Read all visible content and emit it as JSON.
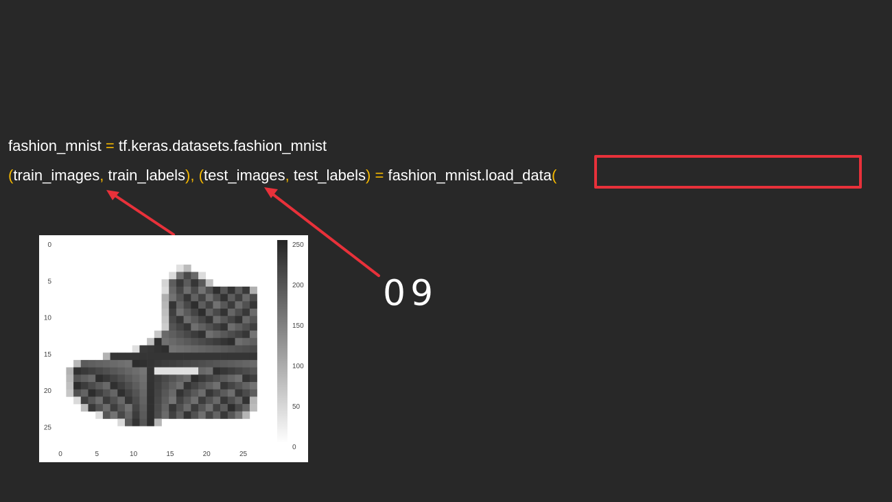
{
  "code": {
    "line1": {
      "var": "fashion_mnist",
      "eq": "=",
      "expr": "tf.keras.datasets.fashion_mnist"
    },
    "line2": {
      "p_open": "(",
      "train_images": "train_images",
      "comma1": ",",
      "train_labels": "train_labels",
      "p_close_comma": "),",
      "p_open2": "(",
      "test_images": "test_images",
      "comma2": ",",
      "test_labels": "test_labels",
      "p_close2": ")",
      "eq": "=",
      "call": "fashion_mnist.load_data",
      "call_paren": "("
    }
  },
  "slide_number": "09",
  "colors": {
    "background": "#282828",
    "punctuation": "#f5b800",
    "annotation_red": "#e8313a"
  },
  "image_plot": {
    "x_ticks": [
      "0",
      "5",
      "10",
      "15",
      "20",
      "25"
    ],
    "y_ticks": [
      "0",
      "5",
      "10",
      "15",
      "20",
      "25"
    ],
    "colorbar_ticks": [
      "250",
      "200",
      "150",
      "100",
      "50",
      "0"
    ],
    "colormap": "gray_r",
    "grid_size": 28
  }
}
